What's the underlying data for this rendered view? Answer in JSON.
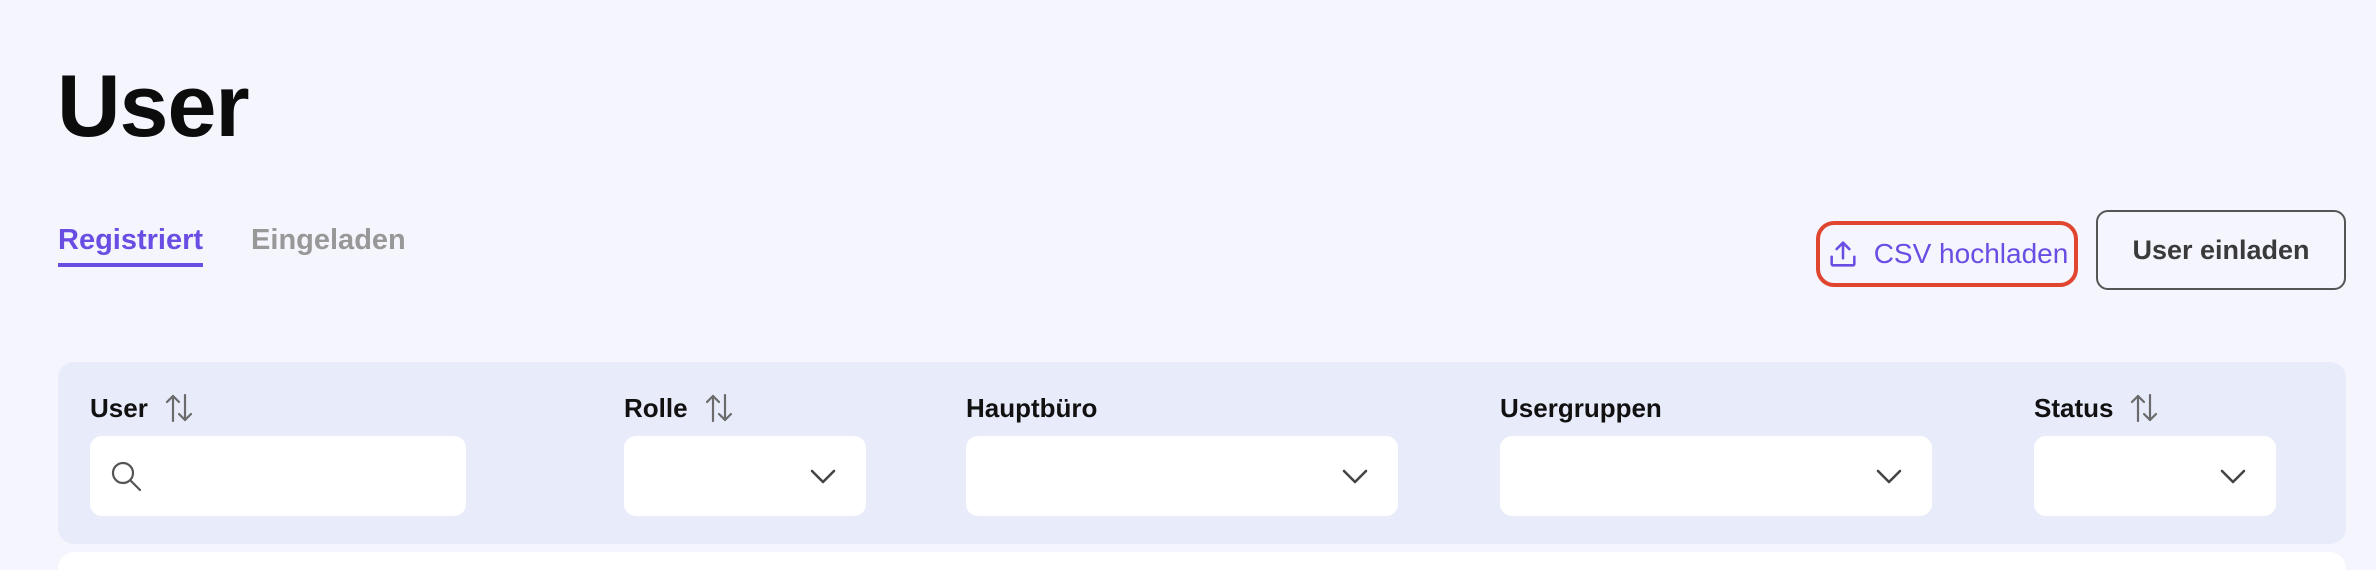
{
  "page": {
    "title": "User"
  },
  "tabs": [
    {
      "label": "Registriert",
      "active": true
    },
    {
      "label": "Eingeladen",
      "active": false
    }
  ],
  "actions": {
    "csv_upload_label": "CSV hochladen",
    "invite_label": "User einladen"
  },
  "filters": {
    "user": {
      "label": "User",
      "value": "",
      "placeholder": ""
    },
    "rolle": {
      "label": "Rolle",
      "value": ""
    },
    "hauptbuero": {
      "label": "Hauptbüro",
      "value": ""
    },
    "usergruppen": {
      "label": "Usergruppen",
      "value": ""
    },
    "status": {
      "label": "Status",
      "value": ""
    }
  },
  "colors": {
    "accent": "#6a4ee3",
    "highlight_outline": "#e04530",
    "background": "#f4f5fd",
    "filter_panel": "#e8ebfa"
  },
  "icons": {
    "upload": "upload-icon",
    "sort": "sort-icon",
    "search": "search-icon",
    "dropdown": "chevron-down-icon"
  }
}
